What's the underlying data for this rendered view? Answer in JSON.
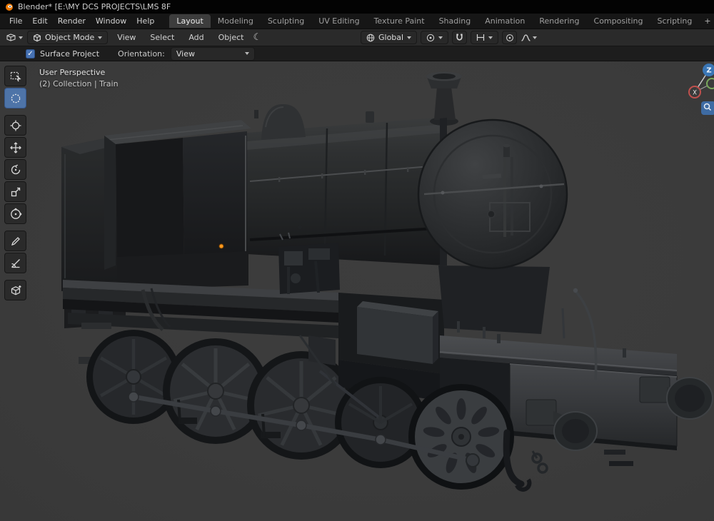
{
  "window": {
    "title": "Blender* [E:\\MY DCS PROJECTS\\LMS 8F"
  },
  "topbar": {
    "menus": [
      {
        "label": "File"
      },
      {
        "label": "Edit"
      },
      {
        "label": "Render"
      },
      {
        "label": "Window"
      },
      {
        "label": "Help"
      }
    ],
    "tabs": [
      {
        "label": "Layout",
        "active": true
      },
      {
        "label": "Modeling"
      },
      {
        "label": "Sculpting"
      },
      {
        "label": "UV Editing"
      },
      {
        "label": "Texture Paint"
      },
      {
        "label": "Shading"
      },
      {
        "label": "Animation"
      },
      {
        "label": "Rendering"
      },
      {
        "label": "Compositing"
      },
      {
        "label": "Scripting"
      }
    ],
    "add_workspace_label": "+"
  },
  "tool_header": {
    "mode": "Object Mode",
    "menus": [
      {
        "label": "View"
      },
      {
        "label": "Select"
      },
      {
        "label": "Add"
      },
      {
        "label": "Object"
      }
    ],
    "orientation": "Global",
    "crescent_glyph": "☾"
  },
  "tool_settings": {
    "surface_project_label": "Surface Project",
    "checkmark": "✓",
    "orientation_label": "Orientation:",
    "orientation_value": "View"
  },
  "toolbar": {
    "tools": [
      {
        "name": "select-box"
      },
      {
        "name": "select-circle",
        "active": true
      },
      {
        "name": "cursor"
      },
      {
        "name": "move"
      },
      {
        "name": "rotate"
      },
      {
        "name": "scale"
      },
      {
        "name": "transform"
      },
      {
        "name": "annotate"
      },
      {
        "name": "measure"
      },
      {
        "name": "add-cube"
      }
    ]
  },
  "viewport": {
    "overlay_line1": "User Perspective",
    "overlay_line2": "(2) Collection | Train",
    "gizmo": {
      "z_label": "Z",
      "x_label": "X"
    },
    "scene_object": "LMS 8F steam locomotive, solid shading"
  },
  "colors": {
    "accent": "#4772b3",
    "viewport_bg": "#3b3b3b",
    "origin_orange": "#ff9a1f",
    "axis_z_blue": "#3a76b5",
    "axis_x_red": "#c0504d"
  }
}
